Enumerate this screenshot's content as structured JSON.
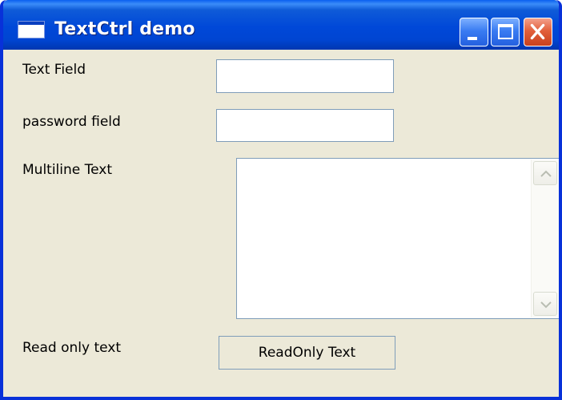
{
  "window": {
    "title": "TextCtrl demo",
    "icon": "window-icon",
    "controls": {
      "minimize_icon": "minimize-icon",
      "maximize_icon": "maximize-icon",
      "close_icon": "close-icon"
    },
    "colors": {
      "titlebar": "#0048d8",
      "frame": "#0831d9",
      "background": "#ece9d8",
      "close_button": "#e2603c"
    }
  },
  "form": {
    "text_field": {
      "label": "Text Field",
      "value": "",
      "placeholder": ""
    },
    "password_field": {
      "label": "password field",
      "value": "",
      "placeholder": ""
    },
    "multiline": {
      "label": "Multiline Text",
      "value": "",
      "scroll_up_icon": "scroll-up-arrow-icon",
      "scroll_down_icon": "scroll-down-arrow-icon"
    },
    "readonly": {
      "label": "Read only text",
      "value": "ReadOnly Text"
    }
  }
}
